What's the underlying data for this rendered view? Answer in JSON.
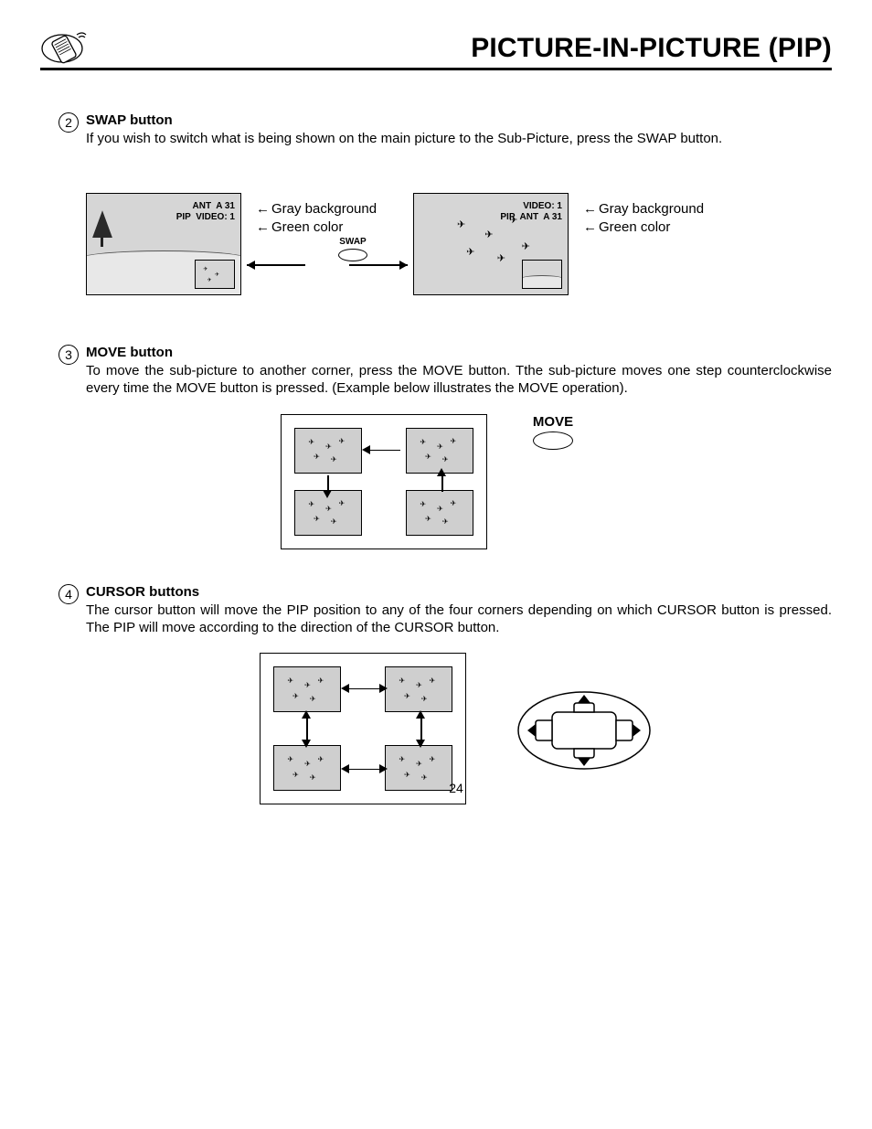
{
  "header": {
    "title": "PICTURE-IN-PICTURE (PIP)"
  },
  "sections": {
    "swap": {
      "num": "2",
      "title": "SWAP button",
      "text": "If you wish to switch what is being shown on the main picture to the Sub-Picture, press the SWAP button.",
      "left_info_line1": "ANT  A 31",
      "left_info_line2": "PIP  VIDEO: 1",
      "right_info_line1": "VIDEO: 1",
      "right_info_line2": "PIP  ANT  A 31",
      "gray_label": "Gray background",
      "green_label": "Green color",
      "swap_label": "SWAP"
    },
    "move": {
      "num": "3",
      "title": "MOVE button",
      "text": "To move the sub-picture to another corner, press the MOVE button. Tthe sub-picture moves one step counterclockwise every time the MOVE button is pressed.  (Example below illustrates the MOVE operation).",
      "move_label": "MOVE"
    },
    "cursor": {
      "num": "4",
      "title": "CURSOR buttons",
      "text": "The cursor button will move the PIP position to any of the four corners depending on which CURSOR button is pressed.  The PIP will move according to the direction of the CURSOR button."
    }
  },
  "page_number": "24"
}
